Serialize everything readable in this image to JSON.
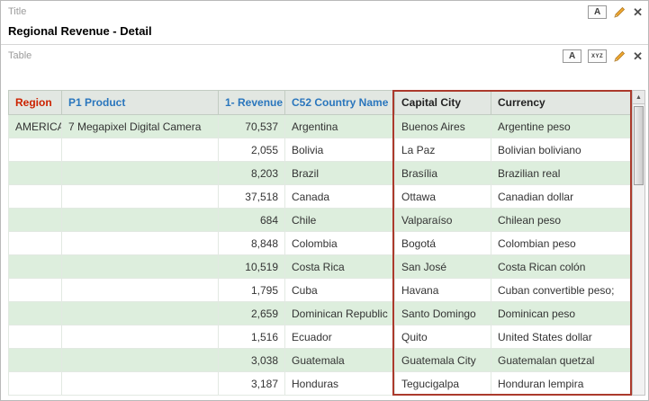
{
  "colors": {
    "selection_border": "#ab3a2c",
    "row_green": "#ddeedd",
    "row_white": "#ffffff",
    "header_bg": "#e2e7e2",
    "region_header_bg": "#c9edf5",
    "region_header_text": "#cc2200",
    "header_link_blue": "#2a76bd",
    "cell_link_blue": "#2a76bd",
    "cell_link_teal": "#1c7a6b"
  },
  "icons": {
    "format_glyph": "A",
    "values_glyph": "XYZ",
    "close_glyph": "✕",
    "up_arrow_glyph": "▲"
  },
  "title_view": {
    "label": "Title",
    "title_text": "Regional Revenue - Detail"
  },
  "table_view": {
    "label": "Table"
  },
  "table": {
    "columns": [
      {
        "key": "region",
        "label": "Region",
        "link": true
      },
      {
        "key": "product",
        "label": "P1 Product",
        "link": true
      },
      {
        "key": "revenue",
        "label": "1- Revenue",
        "link": false
      },
      {
        "key": "country",
        "label": "C52 Country Name",
        "link": true
      },
      {
        "key": "capital",
        "label": "Capital City",
        "link": false
      },
      {
        "key": "currency",
        "label": "Currency",
        "link": false
      }
    ],
    "rows": [
      {
        "region": "AMERICAS",
        "product": "7 Megapixel Digital Camera",
        "revenue": "70,537",
        "country": "Argentina",
        "capital": "Buenos Aires",
        "currency": "Argentine peso"
      },
      {
        "region": "",
        "product": "",
        "revenue": "2,055",
        "country": "Bolivia",
        "capital": "La Paz",
        "currency": "Bolivian boliviano"
      },
      {
        "region": "",
        "product": "",
        "revenue": "8,203",
        "country": "Brazil",
        "capital": "Brasília",
        "currency": "Brazilian real"
      },
      {
        "region": "",
        "product": "",
        "revenue": "37,518",
        "country": "Canada",
        "capital": "Ottawa",
        "currency": "Canadian dollar"
      },
      {
        "region": "",
        "product": "",
        "revenue": "684",
        "country": "Chile",
        "capital": "Valparaíso",
        "currency": "Chilean peso"
      },
      {
        "region": "",
        "product": "",
        "revenue": "8,848",
        "country": "Colombia",
        "capital": "Bogotá",
        "currency": "Colombian peso"
      },
      {
        "region": "",
        "product": "",
        "revenue": "10,519",
        "country": "Costa Rica",
        "capital": "San José",
        "currency": "Costa Rican colón"
      },
      {
        "region": "",
        "product": "",
        "revenue": "1,795",
        "country": "Cuba",
        "capital": "Havana",
        "currency": "Cuban convertible peso;"
      },
      {
        "region": "",
        "product": "",
        "revenue": "2,659",
        "country": "Dominican Republic",
        "capital": "Santo Domingo",
        "currency": "Dominican peso"
      },
      {
        "region": "",
        "product": "",
        "revenue": "1,516",
        "country": "Ecuador",
        "capital": "Quito",
        "currency": "United States dollar"
      },
      {
        "region": "",
        "product": "",
        "revenue": "3,038",
        "country": "Guatemala",
        "capital": "Guatemala City",
        "currency": "Guatemalan quetzal"
      },
      {
        "region": "",
        "product": "",
        "revenue": "3,187",
        "country": "Honduras",
        "capital": "Tegucigalpa",
        "currency": "Honduran lempira"
      }
    ]
  }
}
